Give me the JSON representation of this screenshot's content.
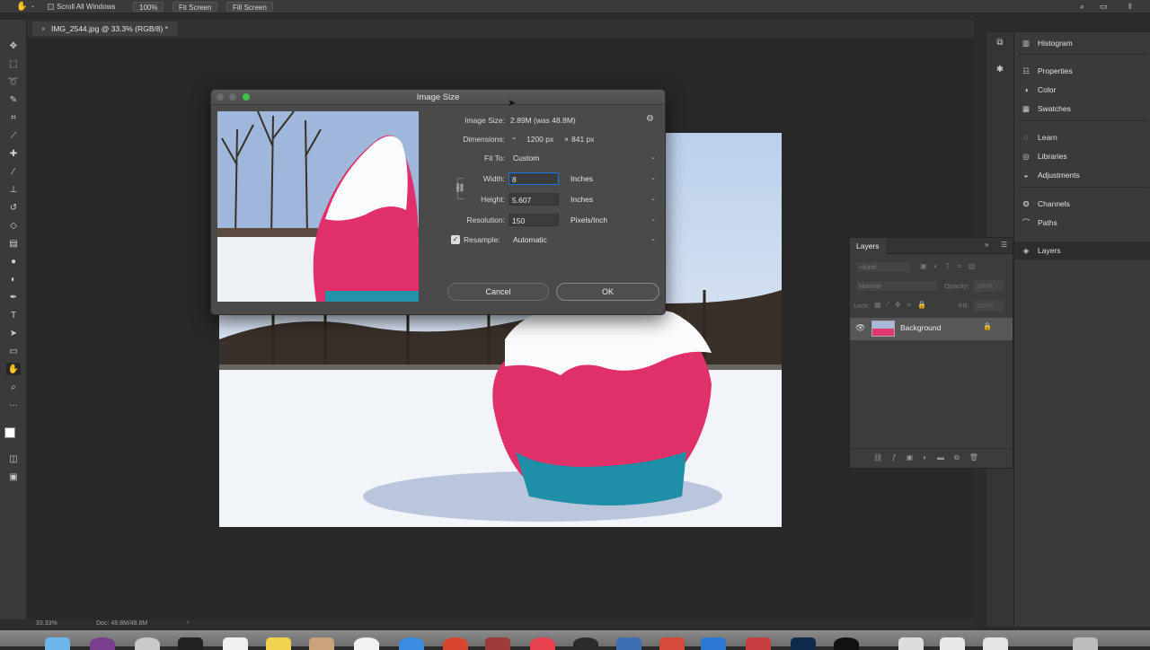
{
  "options_bar": {
    "scroll_all_windows": "Scroll All Windows",
    "zoom_100": "100%",
    "fit_screen": "Fit Screen",
    "fill_screen": "Fill Screen"
  },
  "document": {
    "tab_title": "IMG_2544.jpg @ 33.3% (RGB/8) *"
  },
  "dialog": {
    "title": "Image Size",
    "image_size_label": "Image Size:",
    "image_size_value": "2.89M (was 48.8M)",
    "dimensions_label": "Dimensions:",
    "dimensions_w": "1200 px",
    "dimensions_x": "×",
    "dimensions_h": "841 px",
    "fit_to_label": "Fit To:",
    "fit_to_value": "Custom",
    "width_label": "Width:",
    "width_value": "8",
    "width_unit": "Inches",
    "height_label": "Height:",
    "height_value": "5.607",
    "height_unit": "Inches",
    "resolution_label": "Resolution:",
    "resolution_value": "150",
    "resolution_unit": "Pixels/Inch",
    "resample_label": "Resample:",
    "resample_value": "Automatic",
    "cancel_label": "Cancel",
    "ok_label": "OK"
  },
  "panels": {
    "items": [
      {
        "label": "Histogram",
        "icon": "histogram-icon"
      },
      {
        "label": "Properties",
        "icon": "properties-icon"
      },
      {
        "label": "Color",
        "icon": "color-icon"
      },
      {
        "label": "Swatches",
        "icon": "swatches-icon"
      },
      {
        "label": "Learn",
        "icon": "learn-icon"
      },
      {
        "label": "Libraries",
        "icon": "libraries-icon"
      },
      {
        "label": "Adjustments",
        "icon": "adjustments-icon"
      },
      {
        "label": "Channels",
        "icon": "channels-icon"
      },
      {
        "label": "Paths",
        "icon": "paths-icon"
      },
      {
        "label": "Layers",
        "icon": "layers-icon"
      }
    ]
  },
  "layers_panel": {
    "tab_label": "Layers",
    "kind_placeholder": "Kind",
    "blend_mode": "Normal",
    "opacity_label": "Opacity:",
    "opacity_value": "100%",
    "lock_label": "Lock:",
    "fill_label": "Fill:",
    "fill_value": "100%",
    "layer_name": "Background"
  },
  "status_bar": {
    "zoom": "33.33%",
    "doc_size": "Doc: 48.8M/48.8M"
  },
  "colors": {
    "accent_blue": "#1473e6",
    "dialog_bg": "#4a4a4a",
    "panel_bg": "#3a3a3a"
  }
}
